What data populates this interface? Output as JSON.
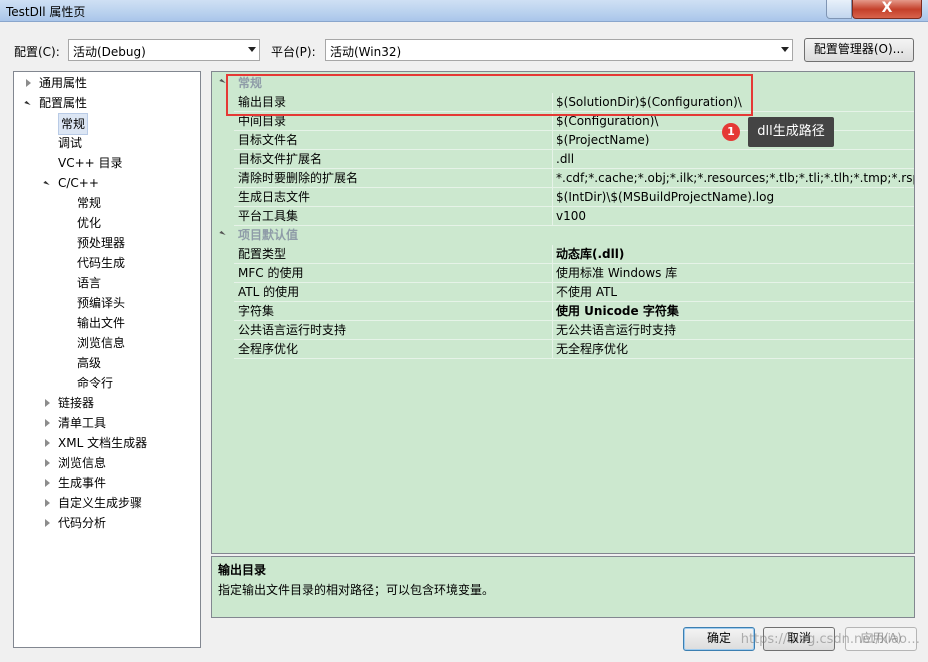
{
  "window": {
    "title": "TestDll 属性页",
    "close_label": "X"
  },
  "toolbar": {
    "config_label": "配置(C):",
    "config_value": "活动(Debug)",
    "platform_label": "平台(P):",
    "platform_value": "活动(Win32)",
    "config_manager_label": "配置管理器(O)..."
  },
  "tree": [
    {
      "label": "通用属性",
      "level": 0,
      "state": "collapsed"
    },
    {
      "label": "配置属性",
      "level": 0,
      "state": "expanded"
    },
    {
      "label": "常规",
      "level": 1,
      "state": "leaf",
      "selected": true
    },
    {
      "label": "调试",
      "level": 1,
      "state": "leaf"
    },
    {
      "label": "VC++ 目录",
      "level": 1,
      "state": "leaf"
    },
    {
      "label": "C/C++",
      "level": 1,
      "state": "expanded"
    },
    {
      "label": "常规",
      "level": 2,
      "state": "leaf"
    },
    {
      "label": "优化",
      "level": 2,
      "state": "leaf"
    },
    {
      "label": "预处理器",
      "level": 2,
      "state": "leaf"
    },
    {
      "label": "代码生成",
      "level": 2,
      "state": "leaf"
    },
    {
      "label": "语言",
      "level": 2,
      "state": "leaf"
    },
    {
      "label": "预编译头",
      "level": 2,
      "state": "leaf"
    },
    {
      "label": "输出文件",
      "level": 2,
      "state": "leaf"
    },
    {
      "label": "浏览信息",
      "level": 2,
      "state": "leaf"
    },
    {
      "label": "高级",
      "level": 2,
      "state": "leaf"
    },
    {
      "label": "命令行",
      "level": 2,
      "state": "leaf"
    },
    {
      "label": "链接器",
      "level": 1,
      "state": "collapsed"
    },
    {
      "label": "清单工具",
      "level": 1,
      "state": "collapsed"
    },
    {
      "label": "XML 文档生成器",
      "level": 1,
      "state": "collapsed"
    },
    {
      "label": "浏览信息",
      "level": 1,
      "state": "collapsed"
    },
    {
      "label": "生成事件",
      "level": 1,
      "state": "collapsed"
    },
    {
      "label": "自定义生成步骤",
      "level": 1,
      "state": "collapsed"
    },
    {
      "label": "代码分析",
      "level": 1,
      "state": "collapsed"
    }
  ],
  "grid": [
    {
      "type": "category",
      "label": "常规"
    },
    {
      "type": "row",
      "name": "输出目录",
      "value": "$(SolutionDir)$(Configuration)\\"
    },
    {
      "type": "row",
      "name": "中间目录",
      "value": "$(Configuration)\\"
    },
    {
      "type": "row",
      "name": "目标文件名",
      "value": "$(ProjectName)"
    },
    {
      "type": "row",
      "name": "目标文件扩展名",
      "value": ".dll"
    },
    {
      "type": "row",
      "name": "清除时要删除的扩展名",
      "value": "*.cdf;*.cache;*.obj;*.ilk;*.resources;*.tlb;*.tli;*.tlh;*.tmp;*.rsp;*.pgc"
    },
    {
      "type": "row",
      "name": "生成日志文件",
      "value": "$(IntDir)\\$(MSBuildProjectName).log"
    },
    {
      "type": "row",
      "name": "平台工具集",
      "value": "v100"
    },
    {
      "type": "category",
      "label": "项目默认值"
    },
    {
      "type": "row",
      "name": "配置类型",
      "value": "动态库(.dll)",
      "bold": true
    },
    {
      "type": "row",
      "name": "MFC 的使用",
      "value": "使用标准 Windows 库"
    },
    {
      "type": "row",
      "name": "ATL 的使用",
      "value": "不使用 ATL"
    },
    {
      "type": "row",
      "name": "字符集",
      "value": "使用 Unicode 字符集",
      "bold": true
    },
    {
      "type": "row",
      "name": "公共语言运行时支持",
      "value": "无公共语言运行时支持"
    },
    {
      "type": "row",
      "name": "全程序优化",
      "value": "无全程序优化"
    }
  ],
  "description": {
    "title": "输出目录",
    "text": "指定输出文件目录的相对路径；可以包含环境变量。"
  },
  "annotation": {
    "badge": "1",
    "text": "dll生成路径"
  },
  "buttons": {
    "ok": "确定",
    "cancel": "取消",
    "apply": "应用(A)"
  },
  "watermark": "https://blog.csdn.net/xiao…",
  "colors": {
    "grid_bg": "#cce8cf",
    "highlight": "#e53935",
    "tooltip_bg": "#444444"
  }
}
